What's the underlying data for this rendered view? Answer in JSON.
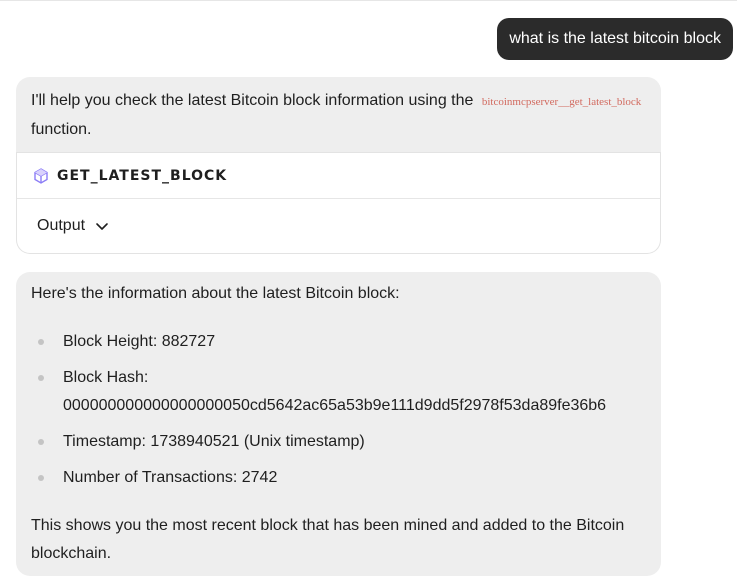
{
  "user_message": "what is the latest bitcoin block",
  "assistant_intro": {
    "before": "I'll help you check the latest Bitcoin block information using the",
    "code": "bitcoinmcpserver__get_latest_block",
    "after": "function."
  },
  "tool": {
    "name": "GET_LATEST_BLOCK",
    "output_label": "Output"
  },
  "answer": {
    "intro": "Here's the information about the latest Bitcoin block:",
    "items": [
      {
        "text": "Block Height: 882727"
      },
      {
        "label": "Block Hash:",
        "value": "000000000000000000050cd5642ac65a53b9e111d9dd5f2978f53da89fe36b6"
      },
      {
        "text": "Timestamp: 1738940521 (Unix timestamp)"
      },
      {
        "text": "Number of Transactions: 2742"
      }
    ],
    "outro": "This shows you the most recent block that has been mined and added to the Bitcoin blockchain."
  },
  "icons": {
    "tool": "cube-icon",
    "output_toggle": "chevron-down-icon"
  },
  "colors": {
    "user_bubble": "#2b2b2b",
    "assistant_bubble": "#eeeeee",
    "code_text": "#d26a5f",
    "cube_accent": "#8b7cf6"
  }
}
